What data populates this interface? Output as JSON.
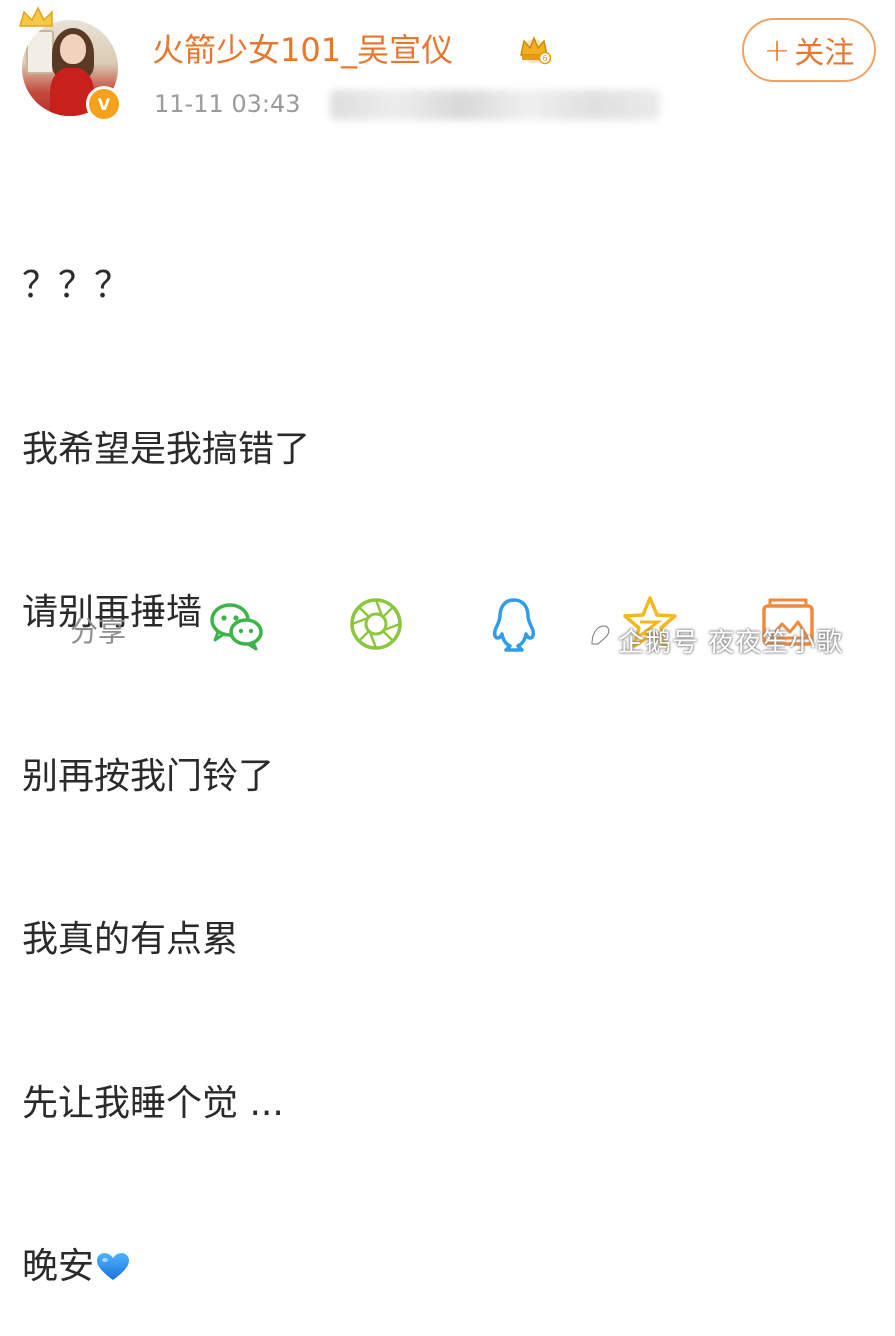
{
  "user": {
    "name": "火箭少女101_吴宣仪",
    "verified_badge": "V",
    "vip_icon": "crown-vip-icon"
  },
  "meta": {
    "timestamp": "11-11 03:43"
  },
  "follow_button": {
    "plus": "+",
    "label": "关注"
  },
  "post": {
    "lines": [
      "？？？",
      "我希望是我搞错了",
      "请别再捶墙",
      "别再按我门铃了",
      "我真的有点累",
      "先让我睡个觉 ...",
      "晚安"
    ],
    "trailing_emoji": "blue-heart-icon"
  },
  "share": {
    "label": "分享",
    "targets": [
      "wechat-icon",
      "moments-icon",
      "qq-icon",
      "qzone-icon",
      "gallery-icon"
    ]
  },
  "watermark": {
    "text": "企鹅号 夜夜笙小歌"
  },
  "colors": {
    "accent": "#e8772e",
    "gray": "#9b9b9b",
    "green": "#4cbf3a",
    "blue": "#2f9de8",
    "gold": "#f4b81c"
  }
}
